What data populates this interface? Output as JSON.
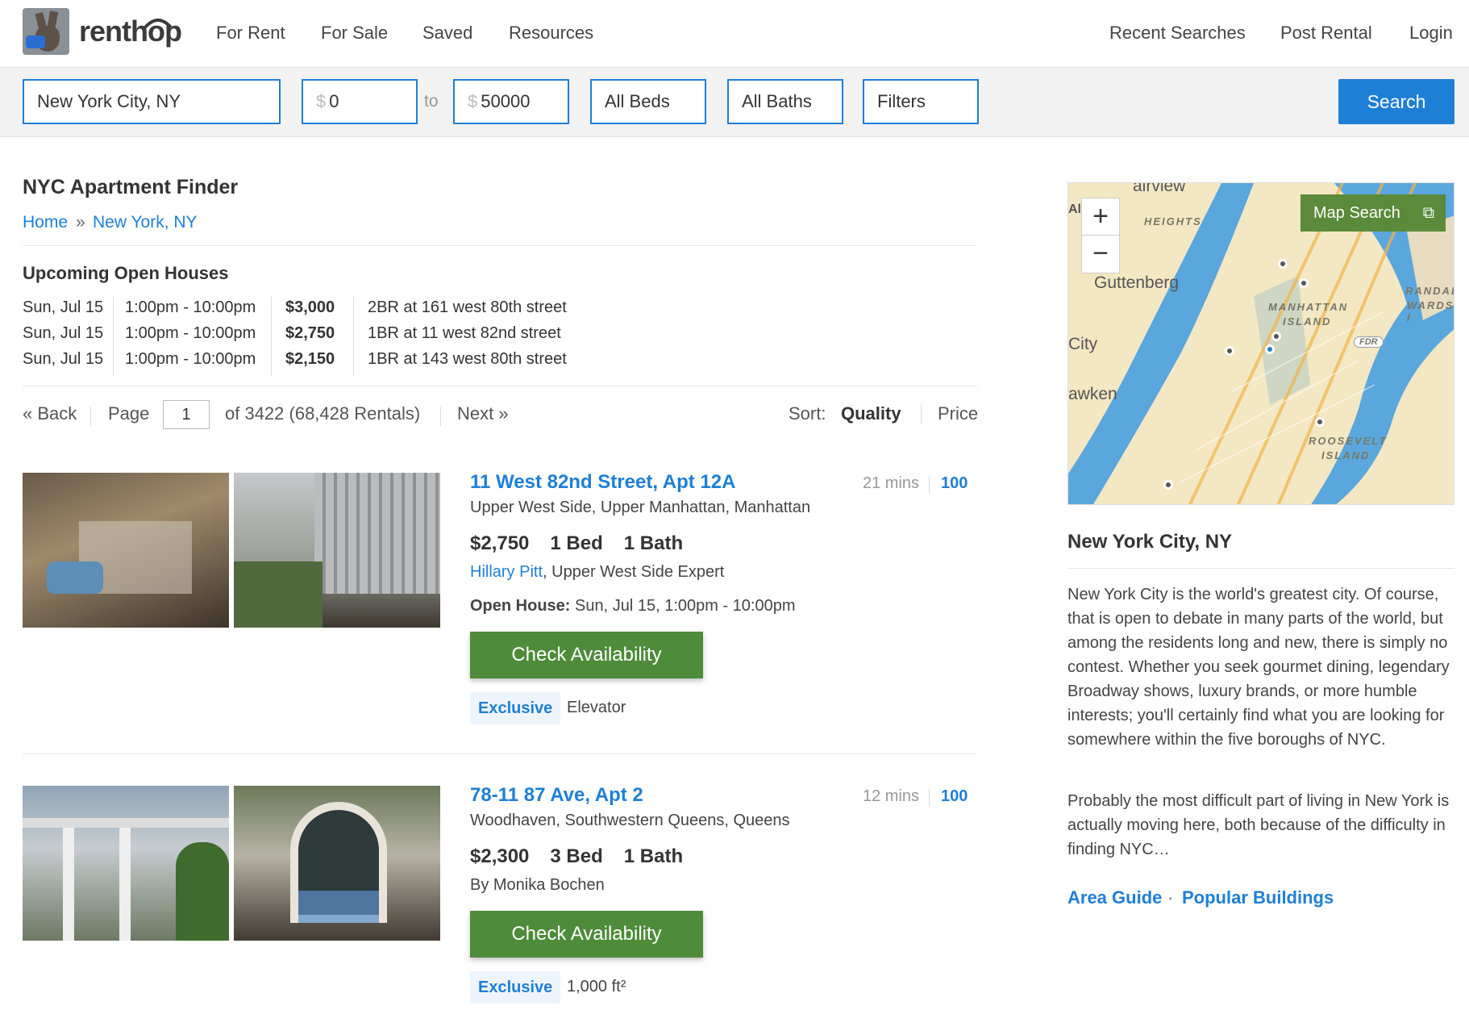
{
  "header": {
    "logo_text": "renthop",
    "nav_left": [
      "For Rent",
      "For Sale",
      "Saved",
      "Resources"
    ],
    "nav_right": [
      "Recent Searches",
      "Post Rental",
      "Login"
    ]
  },
  "search": {
    "location": "New York City, NY",
    "currency_symbol": "$",
    "price_min": "0",
    "to_label": "to",
    "price_max": "50000",
    "beds": "All Beds",
    "baths": "All Baths",
    "filters": "Filters",
    "button": "Search"
  },
  "page": {
    "title": "NYC Apartment Finder",
    "breadcrumb": [
      "Home",
      "»",
      "New York, NY"
    ]
  },
  "open_houses": {
    "title": "Upcoming Open Houses",
    "rows": [
      {
        "date": "Sun, Jul 15",
        "time": "1:00pm - 10:00pm",
        "price": "$3,000",
        "link": "2BR at 161 west 80th street"
      },
      {
        "date": "Sun, Jul 15",
        "time": "1:00pm - 10:00pm",
        "price": "$2,750",
        "link": "1BR at 11 west 82nd street"
      },
      {
        "date": "Sun, Jul 15",
        "time": "1:00pm - 10:00pm",
        "price": "$2,150",
        "link": "1BR at 143 west 80th street"
      }
    ]
  },
  "pager": {
    "back": "« Back",
    "page_label": "Page",
    "page_value": "1",
    "of_text": "of 3422 (68,428 Rentals)",
    "next": "Next »",
    "sort_label": "Sort:",
    "sort_quality": "Quality",
    "sort_price": "Price"
  },
  "listings": [
    {
      "title": "11 West 82nd Street, Apt 12A",
      "location": "Upper West Side, Upper Manhattan, Manhattan",
      "mins": "21 mins",
      "score": "100",
      "price": "$2,750",
      "beds": "1 Bed",
      "baths": "1 Bath",
      "agent_name": "Hillary Pitt",
      "agent_title": ", Upper West Side Expert",
      "open_house_label": "Open House:",
      "open_house_value": "Sun, Jul 15, 1:00pm - 10:00pm",
      "button": "Check Availability",
      "badge": "Exclusive",
      "tag": "Elevator"
    },
    {
      "title": "78-11 87 Ave, Apt 2",
      "location": "Woodhaven, Southwestern Queens, Queens",
      "mins": "12 mins",
      "score": "100",
      "price": "$2,300",
      "beds": "3 Bed",
      "baths": "1 Bath",
      "by_line": "By Monika Bochen",
      "button": "Check Availability",
      "badge": "Exclusive",
      "tag": "1,000 ft²"
    }
  ],
  "map": {
    "zoom_in": "+",
    "zoom_out": "−",
    "search_label": "Map Search",
    "labels": [
      "HEIGHTS",
      "Guttenberg",
      "City",
      "awken",
      "MANHATTAN",
      "ISLAND",
      "FDR",
      "RANDAL",
      "WARDS I",
      "ROOSEVELT",
      "ISLAND",
      "airview",
      "Al"
    ]
  },
  "sidebar": {
    "title": "New York City, NY",
    "para1": "New York City is the world's greatest city. Of course, that is open to debate in many parts of the world, but among the residents long and new, there is simply no contest. Whether you seek gourmet dining, legendary Broadway shows, luxury brands, or more humble interests; you'll certainly find what you are looking for somewhere within the five boroughs of NYC.",
    "para2": "Probably the most difficult part of living in New York is actually moving here, both because of the difficulty in finding NYC…",
    "link1": "Area Guide",
    "dot": "·",
    "link2": "Popular Buildings"
  }
}
